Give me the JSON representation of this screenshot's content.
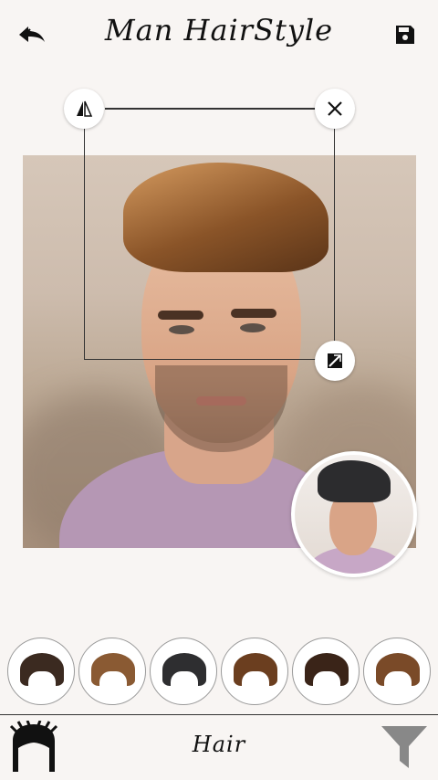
{
  "header": {
    "title": "Man HairStyle",
    "back_icon": "reply-back-icon",
    "save_icon": "floppy-save-icon"
  },
  "editor": {
    "flip_icon": "flip-icon",
    "close_icon": "close-icon",
    "scale_icon": "resize-rotate-icon"
  },
  "hairstyles": [
    {
      "name": "hair-style-1",
      "color": "#3b2a20"
    },
    {
      "name": "hair-style-2",
      "color": "#8a5a33"
    },
    {
      "name": "hair-style-3",
      "color": "#2e2e30"
    },
    {
      "name": "hair-style-4",
      "color": "#6b3e1f"
    },
    {
      "name": "hair-style-5",
      "color": "#3a2418"
    },
    {
      "name": "hair-style-6",
      "color": "#7a4a28"
    }
  ],
  "bottom_bar": {
    "label": "Hair",
    "hair_icon": "hair-category-icon",
    "filter_icon": "filter-icon"
  }
}
